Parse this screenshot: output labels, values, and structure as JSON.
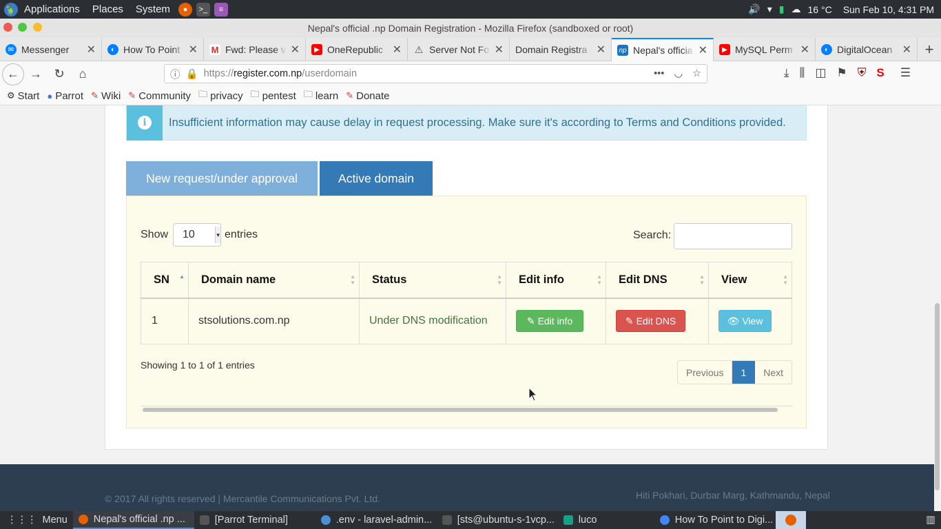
{
  "topbar": {
    "menus": [
      "Applications",
      "Places",
      "System"
    ],
    "temperature": "16 °C",
    "clock": "Sun Feb 10,  4:31 PM"
  },
  "window": {
    "title": "Nepal's official .np Domain Registration - Mozilla Firefox (sandboxed or root)"
  },
  "tabs": [
    {
      "label": "Messenger",
      "icon": "messenger-icon",
      "color": "#0084ff"
    },
    {
      "label": "How To Point",
      "icon": "digitalocean-icon",
      "color": "#0080ff"
    },
    {
      "label": "Fwd: Please v",
      "icon": "gmail-icon",
      "color": "#d93025"
    },
    {
      "label": "OneRepublic",
      "icon": "youtube-icon",
      "color": "#ff0000"
    },
    {
      "label": "Server Not Fo",
      "icon": "warning-icon",
      "color": "#555555"
    },
    {
      "label": "Domain Registra",
      "icon": "",
      "color": "#e8e8e8"
    },
    {
      "label": "Nepal's officia",
      "icon": "np-icon",
      "color": "#1b75bc"
    },
    {
      "label": "MySQL Perm",
      "icon": "youtube-icon",
      "color": "#ff0000"
    },
    {
      "label": "DigitalOcean",
      "icon": "digitalocean-icon",
      "color": "#0080ff"
    }
  ],
  "url": {
    "prefix": "https://",
    "host": "register.com.np",
    "path": "/userdomain"
  },
  "bookmarks": [
    "Start",
    "Parrot",
    "Wiki",
    "Community",
    "privacy",
    "pentest",
    "learn",
    "Donate"
  ],
  "alert": {
    "text": "Insufficient information may cause delay in request processing. Make sure it's according to Terms and Conditions provided."
  },
  "panel_tabs": {
    "pending": "New request/under approval",
    "active": "Active domain"
  },
  "table_controls": {
    "show_label": "Show",
    "entries_value": "10",
    "entries_label": "entries",
    "search_label": "Search:"
  },
  "table": {
    "headers": [
      "SN",
      "Domain name",
      "Status",
      "Edit info",
      "Edit DNS",
      "View"
    ],
    "rows": [
      {
        "sn": "1",
        "domain": "stsolutions.com.np",
        "status": "Under DNS modification",
        "edit_info": "Edit info",
        "edit_dns": "Edit DNS",
        "view": "View"
      }
    ]
  },
  "pagination": {
    "info": "Showing 1 to 1 of 1 entries",
    "previous": "Previous",
    "current": "1",
    "next": "Next"
  },
  "footer": {
    "copyright": "© 2017 All rights reserved | Mercantile Communications Pvt. Ltd.",
    "address": "Hiti Pokhari, Durbar Marg, Kathmandu, Nepal"
  },
  "taskbar": {
    "menu": "Menu",
    "items": [
      "Nepal's official .np ...",
      "[Parrot Terminal]",
      ".env - laravel-admin...",
      "[sts@ubuntu-s-1vcp...",
      "luco",
      "How To Point to Digi..."
    ]
  },
  "colors": {
    "primary": "#337ab7",
    "success": "#5cb85c",
    "danger": "#d9534f",
    "info": "#5bc0de",
    "footer": "#2c3e50"
  }
}
